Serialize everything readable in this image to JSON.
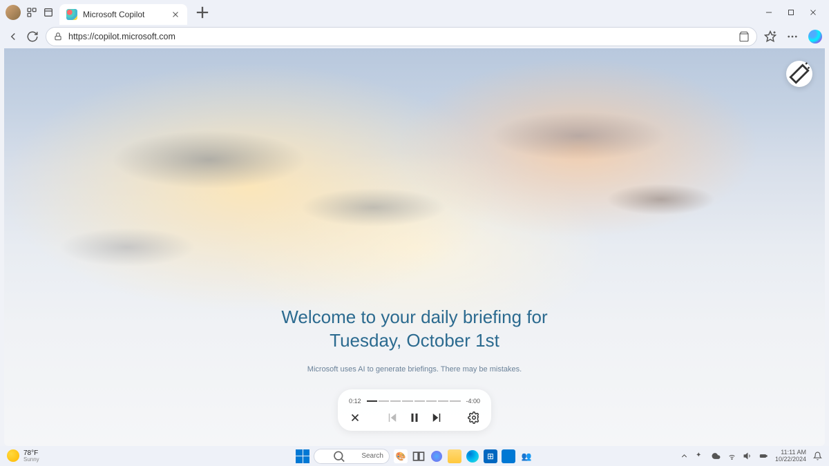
{
  "browser": {
    "tab_title": "Microsoft Copilot",
    "url": "https://copilot.microsoft.com"
  },
  "briefing": {
    "title_line1": "Welcome to your daily briefing for",
    "title_line2": "Tuesday, October 1st",
    "disclaimer": "Microsoft uses AI to generate briefings. There may be mistakes."
  },
  "player": {
    "elapsed": "0:12",
    "remaining": "-4:00"
  },
  "taskbar": {
    "weather_temp": "78°F",
    "weather_cond": "Sunny",
    "search_placeholder": "Search",
    "time": "11:11 AM",
    "date": "10/22/2024"
  }
}
